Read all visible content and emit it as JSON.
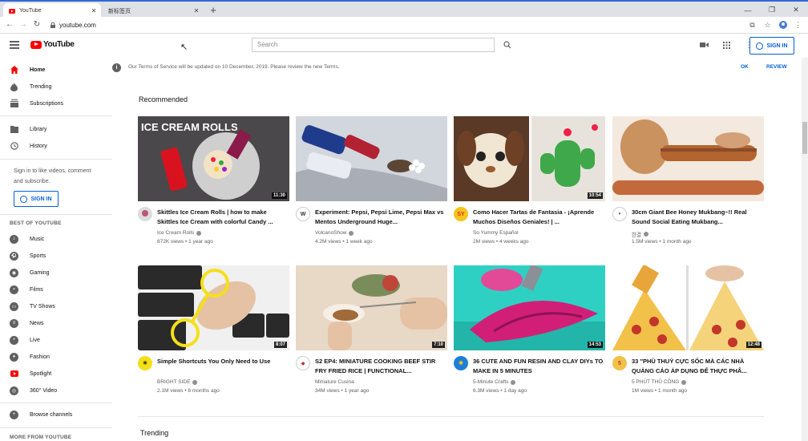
{
  "browser": {
    "tabs": [
      {
        "title": "YouTube",
        "active": true
      },
      {
        "title": "新标签页",
        "active": false
      }
    ],
    "new_tab": "+",
    "url": "youtube.com",
    "window_controls": [
      "—",
      "❐",
      "✕"
    ]
  },
  "header": {
    "logo_text": "YouTube",
    "search_placeholder": "Search",
    "signin_label": "SIGN IN"
  },
  "sidebar": {
    "main": [
      {
        "label": "Home",
        "icon": "home-icon",
        "selected": true
      },
      {
        "label": "Trending",
        "icon": "trending-icon",
        "selected": false
      },
      {
        "label": "Subscriptions",
        "icon": "subscriptions-icon",
        "selected": false
      }
    ],
    "library": [
      {
        "label": "Library",
        "icon": "library-icon"
      },
      {
        "label": "History",
        "icon": "history-icon"
      }
    ],
    "signin_prompt": "Sign in to like videos, comment and subscribe.",
    "signin_label": "SIGN IN",
    "best_header": "BEST OF YOUTUBE",
    "best": [
      {
        "label": "Music",
        "icon": "music-icon"
      },
      {
        "label": "Sports",
        "icon": "sports-icon"
      },
      {
        "label": "Gaming",
        "icon": "gaming-icon"
      },
      {
        "label": "Films",
        "icon": "films-icon"
      },
      {
        "label": "TV Shows",
        "icon": "tv-shows-icon"
      },
      {
        "label": "News",
        "icon": "news-icon"
      },
      {
        "label": "Live",
        "icon": "live-icon"
      },
      {
        "label": "Fashion",
        "icon": "fashion-icon"
      },
      {
        "label": "Spotlight",
        "icon": "spotlight-icon"
      },
      {
        "label": "360° Video",
        "icon": "360-video-icon"
      }
    ],
    "browse_channels": "Browse channels",
    "more_header": "MORE FROM YOUTUBE"
  },
  "notice": {
    "message": "Our Terms of Service will be updated on 10 December, 2019. Please review the new Terms.",
    "ok_label": "OK",
    "review_label": "REVIEW"
  },
  "recommended": {
    "title": "Recommended",
    "videos": [
      {
        "title": "Skittles Ice Cream Rolls | how to make Skittles Ice Cream with colorful Candy ...",
        "channel": "Ice Cream Rolls",
        "verified": true,
        "views": "872K views",
        "age": "1 year ago",
        "duration": "11:30",
        "thumb_text": "ICE CREAM ROLLS",
        "colors": {
          "bg": "#3c3a3d",
          "accent": "#d8121f"
        }
      },
      {
        "title": "Experiment: Pepsi, Pepsi Lime, Pepsi Max vs Mentos Underground Huge...",
        "channel": "VolcanoShow",
        "verified": true,
        "views": "4.2M views",
        "age": "1 week ago",
        "duration": "",
        "colors": {
          "bg": "#cfd4dc",
          "accent": "#1f3c8c"
        }
      },
      {
        "title": "Como Hacer Tartas de Fantasia - ¡Aprende Muchos Diseños Geniales! | ...",
        "channel": "So Yummy Español",
        "verified": false,
        "views": "2M views",
        "age": "4 weeks ago",
        "duration": "10:54",
        "colors": {
          "bg": "#5a3a26",
          "accent": "#3fa84a"
        }
      },
      {
        "title": "30cm Giant Bee Honey Mukbang~!! Real Sound Social Eating Mukbang...",
        "channel": "한결",
        "verified": true,
        "views": "1.5M views",
        "age": "1 month ago",
        "duration": "",
        "colors": {
          "bg": "#c9925f",
          "accent": "#8a4b2a"
        }
      }
    ]
  },
  "row2": {
    "videos": [
      {
        "title": "Simple Shortcuts You Only Need to Use",
        "channel": "BRIGHT SIDE",
        "verified": true,
        "views": "2.1M views",
        "age": "8 months ago",
        "duration": "8:07",
        "colors": {
          "bg": "#2a2a2a",
          "accent": "#f4e01a"
        }
      },
      {
        "title": "S2 EP4: MINIATURE COOKING BEEF STIR FRY FRIED RICE | FUNCTIONAL...",
        "channel": "Miniature Cusina",
        "verified": false,
        "views": "34M views",
        "age": "1 year ago",
        "duration": "7:10",
        "colors": {
          "bg": "#e8d8c6",
          "accent": "#c0463a"
        }
      },
      {
        "title": "36 CUTE AND FUN RESIN AND CLAY DIYs TO MAKE IN 5 MINUTES",
        "channel": "5-Minute Crafts",
        "verified": true,
        "views": "6.3M views",
        "age": "1 day ago",
        "duration": "14:53",
        "colors": {
          "bg": "#2fd0c4",
          "accent": "#d11f77"
        }
      },
      {
        "title": "33 ″PHÙ THUỶ CỰC SỐC MÀ CÁC NHÀ QUẢNG CÁO ÁP DỤNG ĐỂ THỰC PHẨ...",
        "channel": "5 PHÚT THỦ CÔNG",
        "verified": true,
        "views": "1M views",
        "age": "1 month ago",
        "duration": "12:48",
        "colors": {
          "bg": "#f2c14a",
          "accent": "#c3362a"
        }
      }
    ]
  },
  "trending": {
    "title": "Trending"
  }
}
